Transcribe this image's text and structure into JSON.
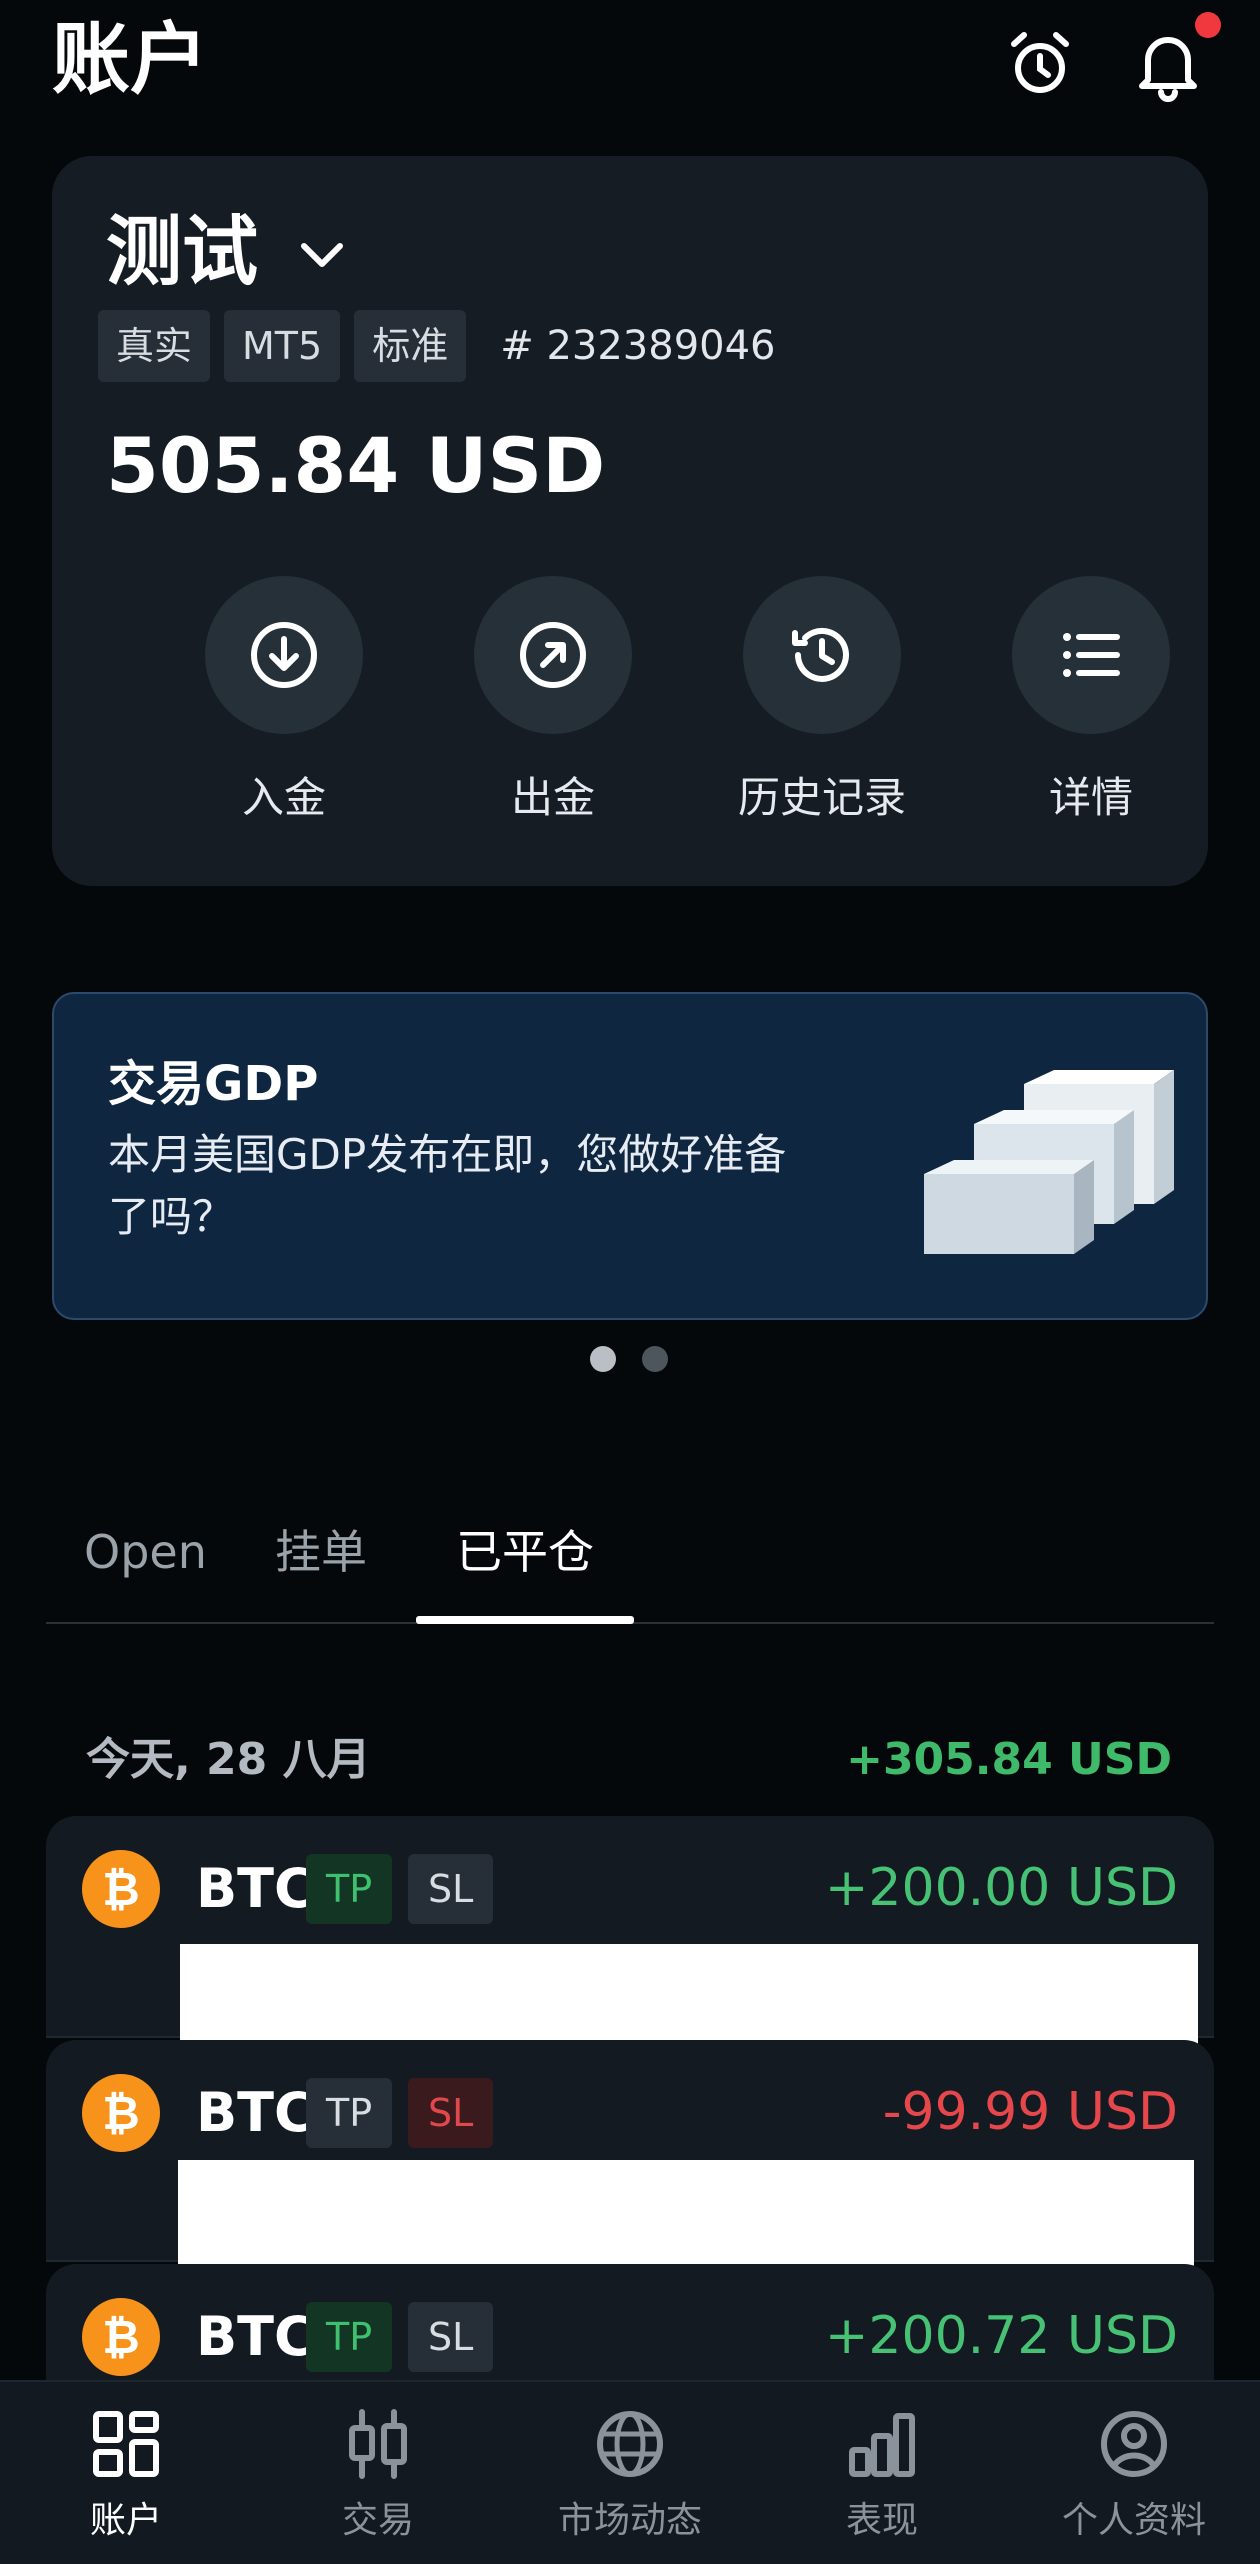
{
  "header": {
    "title": "账户"
  },
  "account": {
    "name": "测试",
    "tags": [
      "真实",
      "MT5",
      "标准"
    ],
    "number": "# 232389046",
    "balance": "505.84 USD",
    "actions": [
      {
        "label": "入金",
        "icon": "deposit-icon"
      },
      {
        "label": "出金",
        "icon": "withdraw-icon"
      },
      {
        "label": "历史记录",
        "icon": "history-icon"
      },
      {
        "label": "详情",
        "icon": "details-icon"
      }
    ]
  },
  "promo": {
    "title": "交易GDP",
    "text": "本月美国GDP发布在即，您做好准备了吗？",
    "pages": 2,
    "active_page": 1
  },
  "tabs": [
    "Open",
    "挂单",
    "已平仓"
  ],
  "active_tab": 2,
  "closed": {
    "day_label": "今天, 28 八月",
    "day_total": "+305.84 USD",
    "trades": [
      {
        "symbol": "BTC",
        "tp": "TP",
        "sl": "SL",
        "hit": "tp",
        "pnl": "+200.00 USD"
      },
      {
        "symbol": "BTC",
        "tp": "TP",
        "sl": "SL",
        "hit": "sl",
        "pnl": "-99.99 USD"
      },
      {
        "symbol": "BTC",
        "tp": "TP",
        "sl": "SL",
        "hit": "tp",
        "pnl": "+200.72 USD"
      }
    ]
  },
  "nav": {
    "items": [
      {
        "label": "账户",
        "icon": "account-icon"
      },
      {
        "label": "交易",
        "icon": "trade-icon"
      },
      {
        "label": "市场动态",
        "icon": "globe-icon"
      },
      {
        "label": "表现",
        "icon": "performance-icon"
      },
      {
        "label": "个人资料",
        "icon": "profile-icon"
      }
    ],
    "active": 0
  },
  "colors": {
    "positive": "#47c274",
    "negative": "#e5474b",
    "bitcoin": "#f7931a",
    "notification": "#f0383f"
  }
}
